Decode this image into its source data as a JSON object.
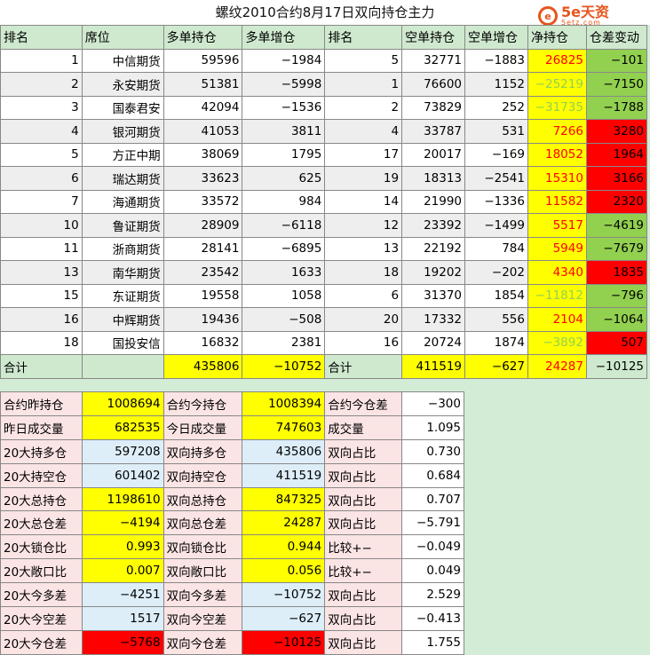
{
  "title": "螺纹2010合约8月17日双向持仓主力",
  "logo": {
    "mark": "e",
    "text": "5e天资",
    "sub": "5etz.com"
  },
  "header": [
    "排名",
    "席位",
    "多单持仓",
    "多单增仓",
    "排名",
    "空单持仓",
    "空单增仓",
    "净持仓",
    "仓差变动"
  ],
  "rows": [
    {
      "rank_long": "1",
      "name": "中信期货",
      "long": "59596",
      "long_chg": "−1984",
      "rank_short": "5",
      "short": "32771",
      "short_chg": "−1883",
      "net": "26825",
      "net_color": "red",
      "diff": "−101",
      "diff_bg": "grn"
    },
    {
      "rank_long": "2",
      "name": "永安期货",
      "long": "51381",
      "long_chg": "−5998",
      "rank_short": "1",
      "short": "76600",
      "short_chg": "1152",
      "net": "−25219",
      "net_color": "grn",
      "diff": "−7150",
      "diff_bg": "grn"
    },
    {
      "rank_long": "3",
      "name": "国泰君安",
      "long": "42094",
      "long_chg": "−1536",
      "rank_short": "2",
      "short": "73829",
      "short_chg": "252",
      "net": "−31735",
      "net_color": "grn",
      "diff": "−1788",
      "diff_bg": "grn"
    },
    {
      "rank_long": "4",
      "name": "银河期货",
      "long": "41053",
      "long_chg": "3811",
      "rank_short": "4",
      "short": "33787",
      "short_chg": "531",
      "net": "7266",
      "net_color": "red",
      "diff": "3280",
      "diff_bg": "red"
    },
    {
      "rank_long": "5",
      "name": "方正中期",
      "long": "38069",
      "long_chg": "1795",
      "rank_short": "17",
      "short": "20017",
      "short_chg": "−169",
      "net": "18052",
      "net_color": "red",
      "diff": "1964",
      "diff_bg": "red"
    },
    {
      "rank_long": "6",
      "name": "瑞达期货",
      "long": "33623",
      "long_chg": "625",
      "rank_short": "19",
      "short": "18313",
      "short_chg": "−2541",
      "net": "15310",
      "net_color": "red",
      "diff": "3166",
      "diff_bg": "red"
    },
    {
      "rank_long": "7",
      "name": "海通期货",
      "long": "33572",
      "long_chg": "984",
      "rank_short": "14",
      "short": "21990",
      "short_chg": "−1336",
      "net": "11582",
      "net_color": "red",
      "diff": "2320",
      "diff_bg": "red"
    },
    {
      "rank_long": "10",
      "name": "鲁证期货",
      "long": "28909",
      "long_chg": "−6118",
      "rank_short": "12",
      "short": "23392",
      "short_chg": "−1499",
      "net": "5517",
      "net_color": "red",
      "diff": "−4619",
      "diff_bg": "grn"
    },
    {
      "rank_long": "11",
      "name": "浙商期货",
      "long": "28141",
      "long_chg": "−6895",
      "rank_short": "13",
      "short": "22192",
      "short_chg": "784",
      "net": "5949",
      "net_color": "red",
      "diff": "−7679",
      "diff_bg": "grn"
    },
    {
      "rank_long": "13",
      "name": "南华期货",
      "long": "23542",
      "long_chg": "1633",
      "rank_short": "18",
      "short": "19202",
      "short_chg": "−202",
      "net": "4340",
      "net_color": "red",
      "diff": "1835",
      "diff_bg": "red"
    },
    {
      "rank_long": "15",
      "name": "东证期货",
      "long": "19558",
      "long_chg": "1058",
      "rank_short": "6",
      "short": "31370",
      "short_chg": "1854",
      "net": "−11812",
      "net_color": "grn",
      "diff": "−796",
      "diff_bg": "grn"
    },
    {
      "rank_long": "16",
      "name": "中辉期货",
      "long": "19436",
      "long_chg": "−508",
      "rank_short": "20",
      "short": "17332",
      "short_chg": "556",
      "net": "2104",
      "net_color": "red",
      "diff": "−1064",
      "diff_bg": "grn"
    },
    {
      "rank_long": "18",
      "name": "国投安信",
      "long": "16832",
      "long_chg": "2381",
      "rank_short": "16",
      "short": "20724",
      "short_chg": "1874",
      "net": "−3892",
      "net_color": "grn",
      "diff": "507",
      "diff_bg": "red"
    }
  ],
  "total": {
    "label": "合计",
    "long": "435806",
    "long_chg": "−10752",
    "label2": "合计",
    "short": "411519",
    "short_chg": "−627",
    "net": "24287",
    "diff": "−10125"
  },
  "stats": [
    {
      "l1": "合约昨持仓",
      "v1": "1008694",
      "v1bg": "y",
      "l2": "合约今持仓",
      "v2": "1008394",
      "v2bg": "y",
      "l3": "合约今仓差",
      "v3": "−300"
    },
    {
      "l1": "昨日成交量",
      "v1": "682535",
      "v1bg": "y",
      "l2": "今日成交量",
      "v2": "747603",
      "v2bg": "y",
      "l3": "成交量",
      "v3": "1.095"
    },
    {
      "l1": "20大持多仓",
      "v1": "597208",
      "v1bg": "lb",
      "l2": "双向持多仓",
      "v2": "435806",
      "v2bg": "lb",
      "l3": "双向占比",
      "v3": "0.730"
    },
    {
      "l1": "20大持空仓",
      "v1": "601402",
      "v1bg": "lb",
      "l2": "双向持空仓",
      "v2": "411519",
      "v2bg": "lb",
      "l3": "双向占比",
      "v3": "0.684"
    },
    {
      "l1": "20大总持仓",
      "v1": "1198610",
      "v1bg": "y",
      "l2": "双向总持仓",
      "v2": "847325",
      "v2bg": "y",
      "l3": "双向占比",
      "v3": "0.707"
    },
    {
      "l1": "20大总仓差",
      "v1": "−4194",
      "v1bg": "y",
      "l2": "双向总仓差",
      "v2": "24287",
      "v2bg": "y",
      "l3": "双向占比",
      "v3": "−5.791"
    },
    {
      "l1": "20大锁仓比",
      "v1": "0.993",
      "v1bg": "y",
      "l2": "双向锁仓比",
      "v2": "0.944",
      "v2bg": "y",
      "l3": "比较+−",
      "v3": "−0.049"
    },
    {
      "l1": "20大敞口比",
      "v1": "0.007",
      "v1bg": "y",
      "l2": "双向敞口比",
      "v2": "0.056",
      "v2bg": "y",
      "l3": "比较+−",
      "v3": "0.049"
    },
    {
      "l1": "20大今多差",
      "v1": "−4251",
      "v1bg": "lb",
      "l2": "双向今多差",
      "v2": "−10752",
      "v2bg": "lb",
      "l3": "双向占比",
      "v3": "2.529"
    },
    {
      "l1": "20大今空差",
      "v1": "1517",
      "v1bg": "lb",
      "l2": "双向今空差",
      "v2": "−627",
      "v2bg": "lb",
      "l3": "双向占比",
      "v3": "−0.413"
    },
    {
      "l1": "20大今仓差",
      "v1": "−5768",
      "v1bg": "red",
      "l2": "双向今仓差",
      "v2": "−10125",
      "v2bg": "red",
      "l3": "双向占比",
      "v3": "1.755"
    }
  ]
}
